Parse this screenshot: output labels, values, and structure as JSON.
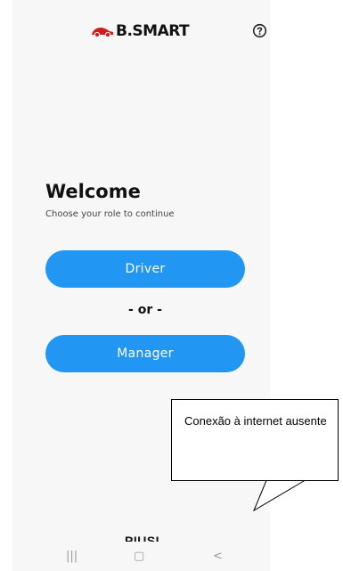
{
  "header": {
    "brand": "B.SMART",
    "help_icon": "help-circle-icon"
  },
  "main": {
    "title": "Welcome",
    "subtitle": "Choose your role to continue",
    "driver_button": "Driver",
    "separator": "- or -",
    "manager_button": "Manager"
  },
  "footer": {
    "logo": "PIUSI",
    "status_icon": "cloud-off-icon"
  },
  "system_nav": {
    "recents_icon": "recents-icon",
    "home_icon": "home-icon",
    "back_icon": "back-icon",
    "recents_glyph": "|||",
    "home_glyph": "▢",
    "back_glyph": "<"
  },
  "callout": {
    "text": "Conexão à internet ausente"
  },
  "colors": {
    "accent": "#2196f3",
    "brand_red": "#d41c1c",
    "background": "#f7f7f7"
  }
}
